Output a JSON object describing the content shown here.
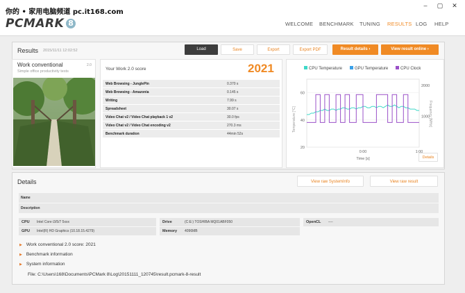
{
  "watermark": "你的 • 家用电脑频道 pc.it168.com",
  "logo": {
    "text": "PCMARK",
    "badge": "8"
  },
  "nav": [
    "WELCOME",
    "BENCHMARK",
    "TUNING",
    "RESULTS",
    "LOG",
    "HELP"
  ],
  "nav_active": "RESULTS",
  "results": {
    "title": "Results",
    "date": "2015/11/11 12:02:52",
    "buttons": {
      "load": "Load",
      "save": "Save",
      "export": "Export",
      "export_pdf": "Export PDF",
      "result_details": "Result details",
      "view_online": "View result online"
    }
  },
  "test": {
    "name": "Work conventional",
    "version": "2.0",
    "subtitle": "Simple office productivity tests"
  },
  "score": {
    "label": "Your Work 2.0 score",
    "value": "2021",
    "rows": [
      {
        "name": "Web Browsing - JunglePin",
        "value": "0.370 s"
      },
      {
        "name": "Web Browsing - Amazonia",
        "value": "0.145 s"
      },
      {
        "name": "Writing",
        "value": "7.99 s"
      },
      {
        "name": "Spreadsheet",
        "value": "30.07 s"
      },
      {
        "name": "Video Chat v2 / Video Chat playback 1 v2",
        "value": "30.0 fps"
      },
      {
        "name": "Video Chat v2 / Video Chat encoding v2",
        "value": "270.3 ms"
      },
      {
        "name": "Benchmark duration",
        "value": "44min 52s"
      }
    ]
  },
  "chart_data": {
    "type": "line",
    "legend": [
      "CPU Temperature",
      "GPU Temperature",
      "CPU Clock"
    ],
    "colors": {
      "cpu_temp": "#3ed8c8",
      "gpu_temp": "#3aa0e8",
      "cpu_clock": "#9a50c8"
    },
    "xlabel": "Time [s]",
    "ylabel_left": "Temperature [°C]",
    "ylabel_right": "Frequency [MHz]",
    "x_ticks": [
      "0:00",
      "1:00"
    ],
    "y_left_ticks": [
      "20",
      "40",
      "60"
    ],
    "y_right_ticks": [
      "2000",
      "1000"
    ],
    "x": [
      0,
      0.02,
      0.04,
      0.06,
      0.08,
      0.1,
      0.12,
      0.14,
      0.16,
      0.18,
      0.2,
      0.22,
      0.24,
      0.26,
      0.28,
      0.3,
      0.32,
      0.34,
      0.36,
      0.38,
      0.4,
      0.42,
      0.44,
      0.46,
      0.48,
      0.5,
      0.52,
      0.54,
      0.56,
      0.58,
      0.6,
      0.62,
      0.64,
      0.66,
      0.68,
      0.7,
      0.72,
      0.74,
      0.76,
      0.78,
      0.8,
      0.82,
      0.84,
      0.86,
      0.88,
      0.9,
      0.92,
      0.94,
      0.96,
      0.98,
      1.0
    ],
    "series": [
      {
        "name": "CPU Temperature",
        "values": [
          44,
          44,
          45,
          45,
          46,
          46,
          47,
          47,
          48,
          47,
          47,
          48,
          48,
          47,
          48,
          48,
          49,
          49,
          48,
          48,
          49,
          49,
          48,
          49,
          49,
          50,
          50,
          49,
          49,
          50,
          50,
          49,
          50,
          50,
          49,
          50,
          51,
          50,
          50,
          51,
          50,
          49,
          50,
          50,
          49,
          49,
          48,
          48,
          48,
          47,
          47
        ]
      },
      {
        "name": "CPU Clock",
        "values": [
          800,
          800,
          800,
          800,
          1700,
          1700,
          800,
          800,
          1700,
          1700,
          800,
          800,
          800,
          1700,
          1700,
          800,
          800,
          1700,
          1700,
          800,
          800,
          800,
          1700,
          1700,
          1700,
          800,
          800,
          800,
          800,
          800,
          800,
          1700,
          1700,
          1700,
          1700,
          1700,
          800,
          800,
          1700,
          1700,
          800,
          800,
          800,
          1700,
          1700,
          800,
          800,
          800,
          800,
          800,
          800
        ]
      }
    ],
    "ylim_left": [
      20,
      70
    ],
    "ylim_right": [
      0,
      2200
    ],
    "details_label": "Details"
  },
  "details": {
    "title": "Details",
    "buttons": {
      "view_sysinfo": "View raw SystemInfo",
      "view_result": "View raw result"
    },
    "name_label": "Name",
    "description_label": "Description",
    "hardware": {
      "cpu_label": "CPU",
      "cpu_value": "Intel Core i3/5/7 5xxx",
      "gpu_label": "GPU",
      "gpu_value": "Intel(R) HD Graphics (10.18.15.4279)",
      "drive_label": "Drive",
      "drive_value": "(C:E:) TOSHIBA MQ01ABF050",
      "memory_label": "Memory",
      "memory_value": "4096MB",
      "opencl_label": "OpenCL",
      "opencl_value": "----"
    },
    "expand_items": [
      "Work conventional 2.0 score: 2021",
      "Benchmark information",
      "System information"
    ],
    "file_path": "File: C:\\Users\\168\\Documents\\PCMark 8\\Log\\20151111_120745\\result.pcmark-8-result"
  }
}
